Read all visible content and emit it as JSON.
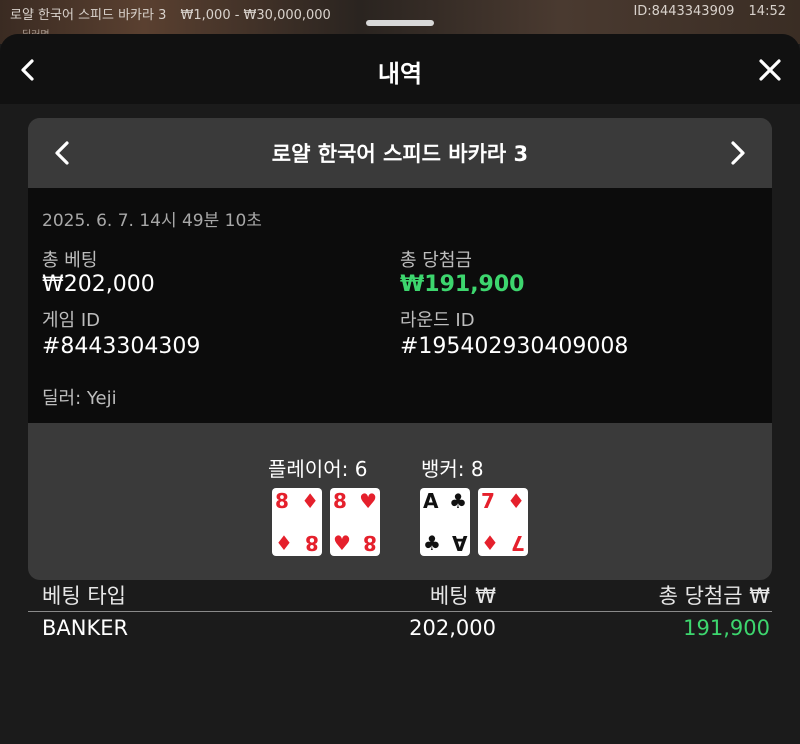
{
  "top_bar": {
    "game_name": "로얄 한국어 스피드 바카라 3",
    "bet_limits": "₩1,000 - ₩30,000,000",
    "player_id": "ID:8443343909",
    "time": "14:52",
    "sub_text": "딜러명"
  },
  "header": {
    "title": "내역"
  },
  "round_card": {
    "game_title": "로얄 한국어 스피드 바카라 3",
    "datetime": "2025. 6. 7. 14시 49분 10초",
    "total_bet_label": "총 베팅",
    "total_bet_value": "₩202,000",
    "total_win_label": "총 당첨금",
    "total_win_value": "₩191,900",
    "game_id_label": "게임 ID",
    "game_id_value": "#8443304309",
    "round_id_label": "라운드 ID",
    "round_id_value": "#195402930409008",
    "dealer": "딜러: Yeji",
    "player_label": "플레이어: 6",
    "banker_label": "뱅커: 8",
    "player_cards": [
      {
        "rank": "8",
        "suit": "♦",
        "color": "#e5202c"
      },
      {
        "rank": "8",
        "suit": "♥",
        "color": "#e5202c"
      }
    ],
    "banker_cards": [
      {
        "rank": "A",
        "suit": "♣",
        "color": "#111111"
      },
      {
        "rank": "7",
        "suit": "♦",
        "color": "#e5202c"
      }
    ]
  },
  "bets_table": {
    "columns": [
      "베팅 타입",
      "베팅 ₩",
      "총 당첨금 ₩"
    ],
    "rows": [
      [
        "BANKER",
        "202,000",
        "191,900"
      ]
    ]
  },
  "colors": {
    "win_green": "#3dd66e",
    "card_red": "#e5202c",
    "panel_gray": "#3a3a3a"
  },
  "icons": {
    "back": "chevron-left-icon",
    "close": "close-icon",
    "prev": "chevron-left-icon",
    "next": "chevron-right-icon"
  }
}
